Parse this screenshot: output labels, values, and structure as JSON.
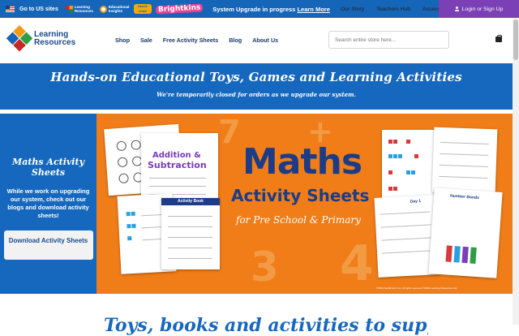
{
  "topbar": {
    "us_link": "Go to US sites",
    "brands": [
      {
        "name": "Learning Resources"
      },
      {
        "name": "Educational Insights"
      },
      {
        "name": "hand2mind"
      },
      {
        "name": "Brightkins"
      }
    ],
    "brand_lr_label": "Learning Resources",
    "brand_ei_label": "Educational Insights",
    "brand_h2m_label": "hand2 mind",
    "brand_brightkins_label": "Brightkins",
    "system_message": "System Upgrade in progress",
    "learn_more": "Learn More",
    "links": [
      "Our Story",
      "Teachers Hub",
      "Accessibility"
    ],
    "login": "Login or Sign Up",
    "accent": "#1565b8",
    "login_color": "#7b3fb6"
  },
  "header": {
    "logo_line1": "Learning",
    "logo_line2": "Resources",
    "nav": [
      "Shop",
      "Sale",
      "Free Activity Sheets",
      "Blog",
      "About Us"
    ],
    "search_placeholder": "Search entire store here...",
    "cart_icon": "shopping-bag-icon"
  },
  "promo": {
    "title": "Hands-on Educational Toys, Games and Learning Activities",
    "subtitle": "We're temporarily closed for orders as we upgrade our system.",
    "background": "#1668be"
  },
  "banner": {
    "left_title": "Maths Activity Sheets",
    "left_text": "While we work on upgrading our system, check out our blogs and download activity sheets!",
    "button": "Download Activity Sheets",
    "main_title": "Maths",
    "main_subtitle": "Activity Sheets",
    "main_tagline": "for Pre School & Primary",
    "book_title_1": "Addition &",
    "book_title_2": "Subtraction",
    "book_label": "Activity Book",
    "day_label": "Day 1",
    "number_bonds_label": "Number Bonds",
    "copyright": "©2024 hand2mind, Inc. All rights reserved. ©2024 Learning Resources Ltd.",
    "background": "#f07d18"
  },
  "bottom": {
    "heading": "Toys, books and activities to support"
  }
}
